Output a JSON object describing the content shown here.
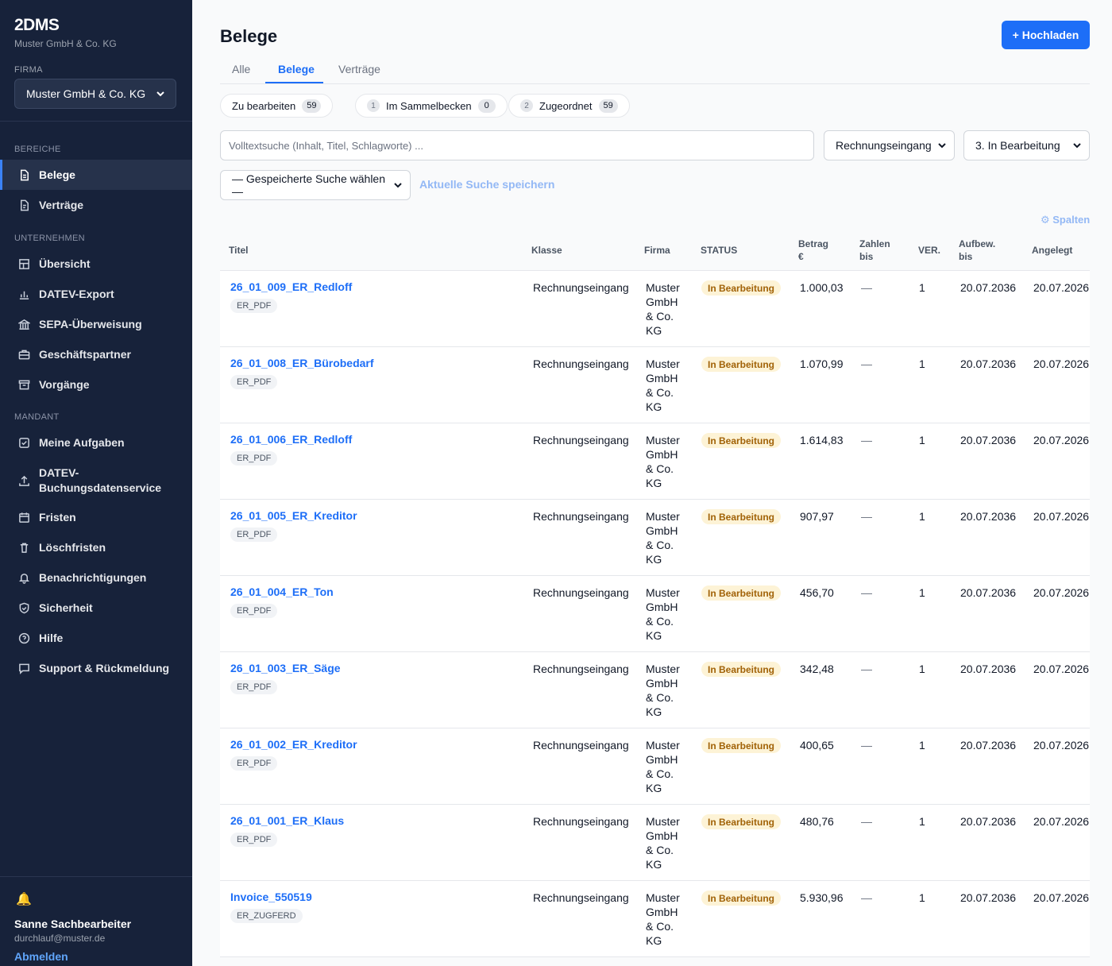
{
  "sidebar": {
    "brand": "2DMS",
    "brand_sub": "Muster GmbH & Co. KG",
    "firma_label": "FIRMA",
    "firma_value": "Muster GmbH & Co. KG",
    "section_bereiche": "BEREICHE",
    "section_unternehmen": "UNTERNEHMEN",
    "section_mandant": "MANDANT",
    "items": [
      {
        "label": "Belege",
        "icon": "document-icon"
      },
      {
        "label": "Verträge",
        "icon": "contract-icon"
      },
      {
        "label": "Übersicht",
        "icon": "dashboard-icon"
      },
      {
        "label": "DATEV-Export",
        "icon": "bar-chart-icon"
      },
      {
        "label": "SEPA-Überweisung",
        "icon": "bank-icon"
      },
      {
        "label": "Geschäftspartner",
        "icon": "briefcase-icon"
      },
      {
        "label": "Vorgänge",
        "icon": "archive-icon"
      },
      {
        "label": "Meine Aufgaben",
        "icon": "checkbox-icon"
      },
      {
        "label": "DATEV-",
        "label2": "Buchungsdatenservice",
        "icon": "upload-icon"
      },
      {
        "label": "Fristen",
        "icon": "calendar-icon"
      },
      {
        "label": "Löschfristen",
        "icon": "trash-icon"
      },
      {
        "label": "Benachrichtigungen",
        "icon": "bell-icon"
      },
      {
        "label": "Sicherheit",
        "icon": "shield-icon"
      },
      {
        "label": "Hilfe",
        "icon": "help-icon"
      },
      {
        "label": "Support & Rückmeldung",
        "icon": "chat-icon"
      }
    ],
    "user": {
      "name": "Sanne Sachbearbeiter",
      "email": "durchlauf@muster.de",
      "logout": "Abmelden"
    }
  },
  "header": {
    "title": "Belege",
    "upload_label": "+ Hochladen"
  },
  "tabs": [
    {
      "label": "Alle"
    },
    {
      "label": "Belege"
    },
    {
      "label": "Verträge"
    }
  ],
  "pills": [
    {
      "num": "",
      "label": "Zu bearbeiten",
      "count": "59"
    },
    {
      "num": "1",
      "label": "Im Sammelbecken",
      "count": "0"
    },
    {
      "num": "2",
      "label": "Zugeordnet",
      "count": "59"
    }
  ],
  "filters": {
    "search_placeholder": "Volltextsuche (Inhalt, Titel, Schlagworte) ...",
    "class_select": "Rechnungseingang",
    "status_select": "3. In Bearbeitung",
    "saved_search": "— Gespeicherte Suche wählen —",
    "save_link": "Aktuelle Suche speichern",
    "columns_link": "⚙ Spalten"
  },
  "table": {
    "headers": {
      "titel": "Titel",
      "klasse": "Klasse",
      "firma": "Firma",
      "status": "STATUS",
      "betrag_1": "Betrag",
      "betrag_2": "€",
      "zahlen_1": "Zahlen",
      "zahlen_2": "bis",
      "ver": "VER.",
      "aufbew_1": "Aufbew.",
      "aufbew_2": "bis",
      "angelegt": "Angelegt"
    },
    "rows": [
      {
        "title": "26_01_009_ER_Redloff",
        "tag": "ER_PDF",
        "klasse": "Rechnungseingang",
        "firma": [
          "Muster",
          "GmbH",
          "& Co.",
          "KG"
        ],
        "status": "In Bearbeitung",
        "betrag": "1.000,03",
        "zahlen": "—",
        "ver": "1",
        "aufbew": "20.07.2036",
        "angelegt": "20.07.2026"
      },
      {
        "title": "26_01_008_ER_Bürobedarf",
        "tag": "ER_PDF",
        "klasse": "Rechnungseingang",
        "firma": [
          "Muster",
          "GmbH",
          "& Co.",
          "KG"
        ],
        "status": "In Bearbeitung",
        "betrag": "1.070,99",
        "zahlen": "—",
        "ver": "1",
        "aufbew": "20.07.2036",
        "angelegt": "20.07.2026"
      },
      {
        "title": "26_01_006_ER_Redloff",
        "tag": "ER_PDF",
        "klasse": "Rechnungseingang",
        "firma": [
          "Muster",
          "GmbH",
          "& Co.",
          "KG"
        ],
        "status": "In Bearbeitung",
        "betrag": "1.614,83",
        "zahlen": "—",
        "ver": "1",
        "aufbew": "20.07.2036",
        "angelegt": "20.07.2026"
      },
      {
        "title": "26_01_005_ER_Kreditor",
        "tag": "ER_PDF",
        "klasse": "Rechnungseingang",
        "firma": [
          "Muster",
          "GmbH",
          "& Co.",
          "KG"
        ],
        "status": "In Bearbeitung",
        "betrag": "907,97",
        "zahlen": "—",
        "ver": "1",
        "aufbew": "20.07.2036",
        "angelegt": "20.07.2026"
      },
      {
        "title": "26_01_004_ER_Ton",
        "tag": "ER_PDF",
        "klasse": "Rechnungseingang",
        "firma": [
          "Muster",
          "GmbH",
          "& Co.",
          "KG"
        ],
        "status": "In Bearbeitung",
        "betrag": "456,70",
        "zahlen": "—",
        "ver": "1",
        "aufbew": "20.07.2036",
        "angelegt": "20.07.2026"
      },
      {
        "title": "26_01_003_ER_Säge",
        "tag": "ER_PDF",
        "klasse": "Rechnungseingang",
        "firma": [
          "Muster",
          "GmbH",
          "& Co.",
          "KG"
        ],
        "status": "In Bearbeitung",
        "betrag": "342,48",
        "zahlen": "—",
        "ver": "1",
        "aufbew": "20.07.2036",
        "angelegt": "20.07.2026"
      },
      {
        "title": "26_01_002_ER_Kreditor",
        "tag": "ER_PDF",
        "klasse": "Rechnungseingang",
        "firma": [
          "Muster",
          "GmbH",
          "& Co.",
          "KG"
        ],
        "status": "In Bearbeitung",
        "betrag": "400,65",
        "zahlen": "—",
        "ver": "1",
        "aufbew": "20.07.2036",
        "angelegt": "20.07.2026"
      },
      {
        "title": "26_01_001_ER_Klaus",
        "tag": "ER_PDF",
        "klasse": "Rechnungseingang",
        "firma": [
          "Muster",
          "GmbH",
          "& Co.",
          "KG"
        ],
        "status": "In Bearbeitung",
        "betrag": "480,76",
        "zahlen": "—",
        "ver": "1",
        "aufbew": "20.07.2036",
        "angelegt": "20.07.2026"
      },
      {
        "title": "Invoice_550519",
        "tag": "ER_ZUGFERD",
        "klasse": "Rechnungseingang",
        "firma": [
          "Muster",
          "GmbH",
          "& Co.",
          "KG"
        ],
        "status": "In Bearbeitung",
        "betrag": "5.930,96",
        "zahlen": "—",
        "ver": "1",
        "aufbew": "20.07.2036",
        "angelegt": "20.07.2026"
      }
    ]
  }
}
